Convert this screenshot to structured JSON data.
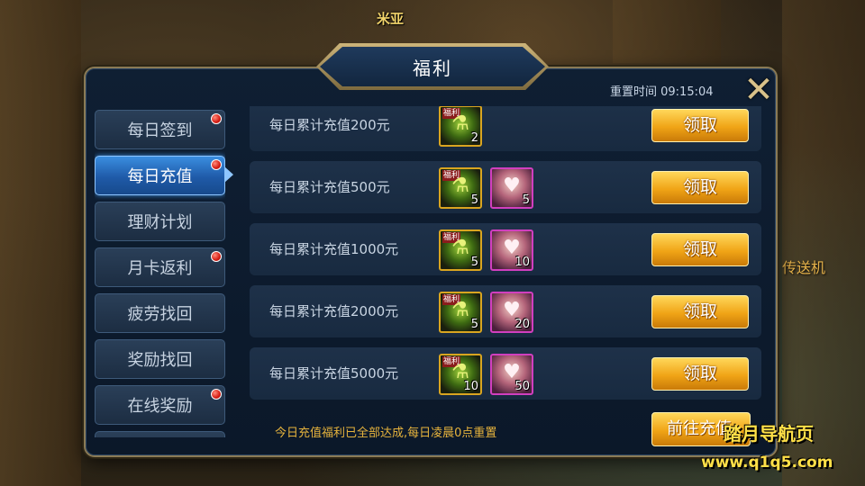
{
  "background": {
    "npc_name": "米亚",
    "teleporter_label": "传送机"
  },
  "panel": {
    "title": "福利",
    "reset_time": "重置时间 09:15:04",
    "close_icon": "close-x-icon"
  },
  "nav": {
    "items": [
      {
        "label": "每日签到",
        "badge": true,
        "active": false
      },
      {
        "label": "每日充值",
        "badge": true,
        "active": true
      },
      {
        "label": "理财计划",
        "badge": false,
        "active": false
      },
      {
        "label": "月卡返利",
        "badge": true,
        "active": false
      },
      {
        "label": "疲劳找回",
        "badge": false,
        "active": false
      },
      {
        "label": "奖励找回",
        "badge": false,
        "active": false
      },
      {
        "label": "在线奖励",
        "badge": true,
        "active": false
      }
    ]
  },
  "rewards": {
    "claim_label": "领取",
    "item_tag": "福利",
    "rows": [
      {
        "label": "每日累计充值200元",
        "items": [
          {
            "icon": "green-potion-icon",
            "count": "2"
          }
        ]
      },
      {
        "label": "每日累计充值500元",
        "items": [
          {
            "icon": "green-potion-icon",
            "count": "5"
          },
          {
            "icon": "character-gift-icon",
            "count": "5"
          }
        ]
      },
      {
        "label": "每日累计充值1000元",
        "items": [
          {
            "icon": "green-potion-icon",
            "count": "5"
          },
          {
            "icon": "character-gift-icon",
            "count": "10"
          }
        ]
      },
      {
        "label": "每日累计充值2000元",
        "items": [
          {
            "icon": "green-potion-icon",
            "count": "5"
          },
          {
            "icon": "character-gift-icon",
            "count": "20"
          }
        ]
      },
      {
        "label": "每日累计充值5000元",
        "items": [
          {
            "icon": "green-potion-icon",
            "count": "10"
          },
          {
            "icon": "character-gift-icon",
            "count": "50"
          }
        ]
      }
    ]
  },
  "footer": {
    "note": "今日充值福利已全部达成,每日凌晨0点重置",
    "goto_label": "前往充值"
  },
  "watermark": {
    "title": "踏月导航页",
    "url": "www.q1q5.com"
  },
  "colors": {
    "accent_gold": "#f0a416",
    "active_tab": "#1f5aa8",
    "badge_red": "#d41b12"
  }
}
